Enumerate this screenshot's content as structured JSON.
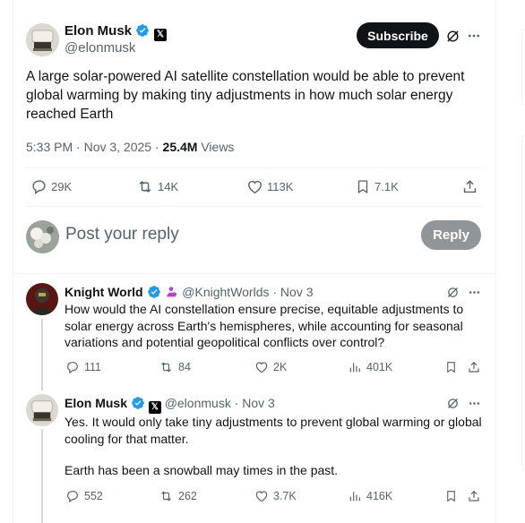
{
  "main_tweet": {
    "author_name": "Elon Musk",
    "author_handle": "@elonmusk",
    "subscribe_label": "Subscribe",
    "text": "A large solar-powered AI satellite constellation would be able to prevent global warming by making tiny adjustments in how much solar energy reached Earth",
    "timestamp": "5:33 PM · Nov 3, 2025 · ",
    "views_count": "25.4M",
    "views_label": " Views",
    "replies": "29K",
    "reposts": "14K",
    "likes": "113K",
    "bookmarks": "7.1K"
  },
  "composer": {
    "placeholder": "Post your reply",
    "reply_label": "Reply"
  },
  "replies": [
    {
      "author_name": "Knight World",
      "handle_time": "@KnightWorlds · Nov 3",
      "text": "How would the AI constellation ensure precise, equitable adjustments to solar energy across Earth's hemispheres, while accounting for seasonal variations and potential geopolitical conflicts over control?",
      "replies": "111",
      "reposts": "84",
      "likes": "2K",
      "views": "401K"
    },
    {
      "author_name": "Elon Musk",
      "handle_time": "@elonmusk · Nov 3",
      "text_p1": "Yes. It would only take tiny adjustments to prevent global warming or global cooling for that matter.",
      "text_p2": "Earth has been a snowball may times in the past.",
      "replies": "552",
      "reposts": "262",
      "likes": "3.7K",
      "views": "416K"
    }
  ],
  "colors": {
    "verified_blue": "#1d9bf0",
    "muted": "#536471",
    "affiliate_purple": "#c13bd3"
  }
}
